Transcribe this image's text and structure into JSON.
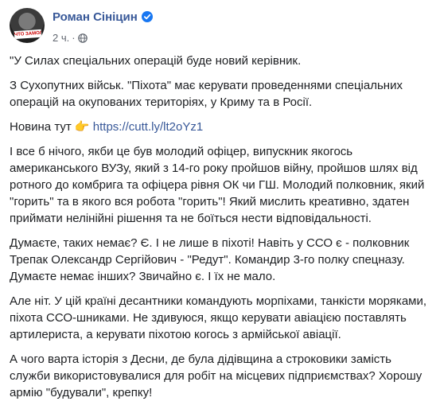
{
  "post": {
    "author_name": "Роман Сініцин",
    "timestamp": "2 ч.",
    "separator": "·",
    "avatar_caption": "ЧТО ЗАМОЛЧАЛИ",
    "icons": {
      "verified": "verified-badge-icon",
      "audience": "globe-icon",
      "link_emoji": "pointing-right-hand-emoji"
    },
    "colors": {
      "author": "#385898",
      "link": "#385898",
      "verified": "#1877f2",
      "meta": "#616770",
      "text": "#1c1e21"
    },
    "paragraphs": {
      "p1": "\"У Силах спеціальних операцій буде новий керівник.",
      "p2": "З Сухопутних військ. \"Піхота\" має керувати проведеннями спеціальних операцій на окупованих територіях, у Криму та в Росії.",
      "p3_prefix": "Новина тут ",
      "p3_emoji": "👉",
      "p3_link": "https://cutt.ly/lt2oYz1",
      "p4": "І все б нічого, якби це був молодий офіцер, випускник якогось американського ВУЗу, який з 14-го року пройшов війну, пройшов шлях від ротного до комбрига та офіцера рівня ОК чи ГШ. Молодий полковник, який \"горить\" та в якого вся робота \"горить\"! Який мислить креативно, здатен приймати нелінійні рішення та не боїться нести відповідальності.",
      "p5": "Думаєте, таких немає? Є. І не лише в піхоті! Навіть у ССО є - полковник Трепак Олександр Сергійович - \"Редут\". Командир 3-го полку спецназу. Думаєте немає інших? Звичайно є. І їх не мало.",
      "p6": "Але ніт. У цій країні десантники командують морпіхами, танкісти моряками, піхота ССО-шниками. Не здивуюся, якщо керувати авіацією поставлять артилериста, а керувати піхотою когось з армійської авіації.",
      "p7": "А чого варта історія з Десни, де була дідівщина а строковики замість служби використовувалися для робіт на місцевих підприємствах? Хорошу армію \"будували\", крепку!"
    }
  }
}
